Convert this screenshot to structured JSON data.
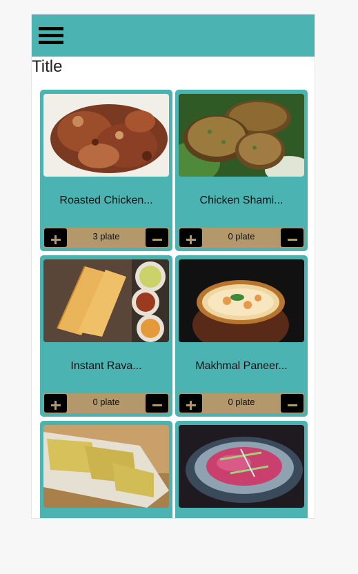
{
  "app": {
    "title": "Title"
  },
  "menu": {
    "icon": "hamburger-menu-icon"
  },
  "colors": {
    "accent": "#4bb3b1",
    "quantity_bar": "#b3986b",
    "button": "#000000"
  },
  "items": [
    {
      "name": "Roasted Chicken...",
      "quantity": "3 plate",
      "image": "roasted-chicken-photo"
    },
    {
      "name": "Chicken Shami...",
      "quantity": "0 plate",
      "image": "chicken-shami-kebab-photo"
    },
    {
      "name": "Instant Rava...",
      "quantity": "0 plate",
      "image": "instant-rava-dosa-photo"
    },
    {
      "name": "Makhmal Paneer...",
      "quantity": "0 plate",
      "image": "makhmal-paneer-photo"
    },
    {
      "name": "",
      "quantity": "",
      "image": "dhokla-photo"
    },
    {
      "name": "",
      "quantity": "",
      "image": "pink-salad-bowl-photo"
    }
  ]
}
